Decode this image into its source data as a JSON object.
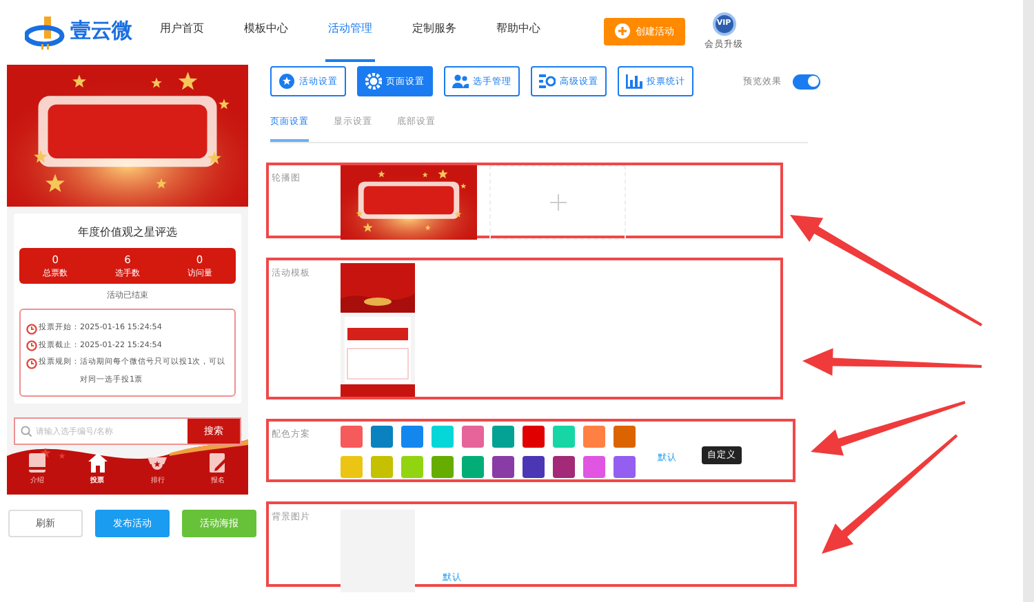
{
  "header": {
    "logo_text": "壹云微",
    "nav": [
      {
        "label": "用户首页",
        "selected": false
      },
      {
        "label": "模板中心",
        "selected": false
      },
      {
        "label": "活动管理",
        "selected": true
      },
      {
        "label": "定制服务",
        "selected": false
      },
      {
        "label": "帮助中心",
        "selected": false
      }
    ],
    "create_button": "创建活动",
    "vip_badge": "VIP",
    "vip_label": "会员升级"
  },
  "preview": {
    "title": "年度价值观之星评选",
    "stats": [
      {
        "value": "0",
        "label": "总票数"
      },
      {
        "value": "6",
        "label": "选手数"
      },
      {
        "value": "0",
        "label": "访问量"
      }
    ],
    "status": "活动已结束",
    "info": [
      {
        "label": "投票开始：",
        "value": "2025-01-16 15:24:54"
      },
      {
        "label": "投票截止：",
        "value": "2025-01-22 15:24:54"
      },
      {
        "label": "投票规则：",
        "value": "活动期间每个微信号只可以投1次，可以对同一选手投1票"
      }
    ],
    "search": {
      "placeholder": "请输入选手编号/名称",
      "button": "搜索"
    },
    "bottom_nav": [
      {
        "label": "介绍",
        "kind": "book",
        "selected": false
      },
      {
        "label": "投票",
        "kind": "home",
        "selected": true
      },
      {
        "label": "排行",
        "kind": "medal",
        "selected": false
      },
      {
        "label": "报名",
        "kind": "edit",
        "selected": false
      }
    ]
  },
  "actions": [
    {
      "label": "刷新",
      "kind": "plain"
    },
    {
      "label": "发布活动",
      "kind": "primary"
    },
    {
      "label": "活动海报",
      "kind": "success"
    }
  ],
  "setting_tabs": [
    {
      "label": "活动设置",
      "kind": "star",
      "selected": false
    },
    {
      "label": "页面设置",
      "kind": "gear",
      "selected": true
    },
    {
      "label": "选手管理",
      "kind": "users",
      "selected": false
    },
    {
      "label": "高级设置",
      "kind": "sliders",
      "selected": false
    },
    {
      "label": "投票统计",
      "kind": "chart",
      "selected": false
    }
  ],
  "preview_toggle": {
    "label": "预览效果",
    "on": true
  },
  "sub_tabs": [
    {
      "label": "页面设置",
      "selected": true
    },
    {
      "label": "显示设置",
      "selected": false
    },
    {
      "label": "底部设置",
      "selected": false
    }
  ],
  "sections": [
    {
      "label": "轮播图",
      "kind": "carousel"
    },
    {
      "label": "活动模板",
      "kind": "template"
    },
    {
      "label": "配色方案",
      "kind": "colors",
      "swatches": [
        {
          "color": "#f65a5a"
        },
        {
          "color": "#0a82c0"
        },
        {
          "color": "#1487ef"
        },
        {
          "color": "#05d6d8"
        },
        {
          "color": "#e6649a"
        },
        {
          "color": "#04a294"
        },
        {
          "color": "#e00000"
        },
        {
          "color": "#17d6a6"
        },
        {
          "color": "#ff8042"
        },
        {
          "color": "#dc6400"
        },
        {
          "color": "#ecc514"
        },
        {
          "color": "#c5c100"
        },
        {
          "color": "#91d510"
        },
        {
          "color": "#65ad00"
        },
        {
          "color": "#03ae76"
        },
        {
          "color": "#8a3ca6"
        },
        {
          "color": "#4b37b5"
        },
        {
          "color": "#a22a78"
        },
        {
          "color": "#e055e2"
        },
        {
          "color": "#945ff0"
        }
      ],
      "default_link": "默认",
      "custom_tooltip": "自定义"
    },
    {
      "label": "背景图片",
      "kind": "background",
      "default_link": "默认"
    }
  ]
}
